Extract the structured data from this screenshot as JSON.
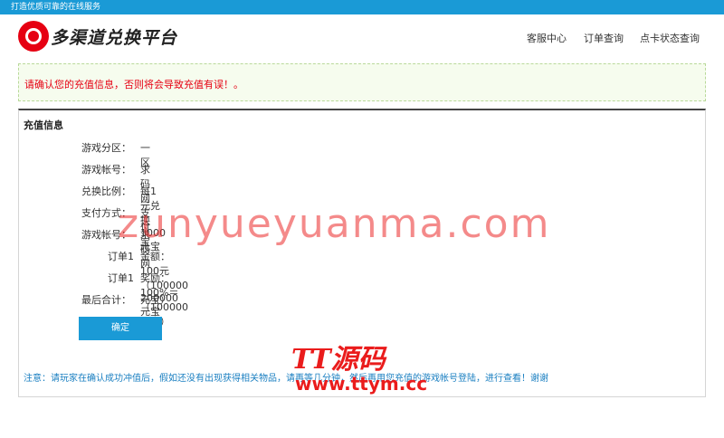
{
  "topbar": {
    "slogan": "打造优质可靠的在线服务"
  },
  "logo": {
    "text": "多渠道兑换平台"
  },
  "nav": {
    "items": [
      "客服中心",
      "订单查询",
      "点卡状态查询"
    ]
  },
  "notice": {
    "text": "请确认您的充值信息，否则将会导致充值有误！。"
  },
  "panel": {
    "title": "充值信息",
    "rows": [
      {
        "label": "游戏分区：",
        "value": "一区"
      },
      {
        "label": "游戏帐号：",
        "value": "求码网"
      },
      {
        "label": "兑换比例：",
        "value": "每1元兑换 1000 元宝"
      },
      {
        "label": "支付方式：",
        "value": "支付宝"
      },
      {
        "label": "游戏帐号：",
        "value": "求码网"
      },
      {
        "label": "订单1",
        "value": "金额：100元（100000元宝）"
      },
      {
        "label": "订单1",
        "value": "奖励：100%＝（100000元宝）"
      },
      {
        "label": "最后合计：",
        "value": "200000元宝"
      }
    ],
    "confirm_label": "确定",
    "tip": "注意：请玩家在确认成功冲值后，假如还没有出现获得相关物品，请再等几分钟，然后再用您充值的游戏帐号登陆，进行查看！谢谢"
  },
  "watermark": {
    "line1": "zunyueyuanma.com",
    "line2": "TT源码",
    "line3": "www.ttym.cc"
  },
  "colors": {
    "brand_blue": "#1a9ad6",
    "alert_red": "#e60012"
  }
}
